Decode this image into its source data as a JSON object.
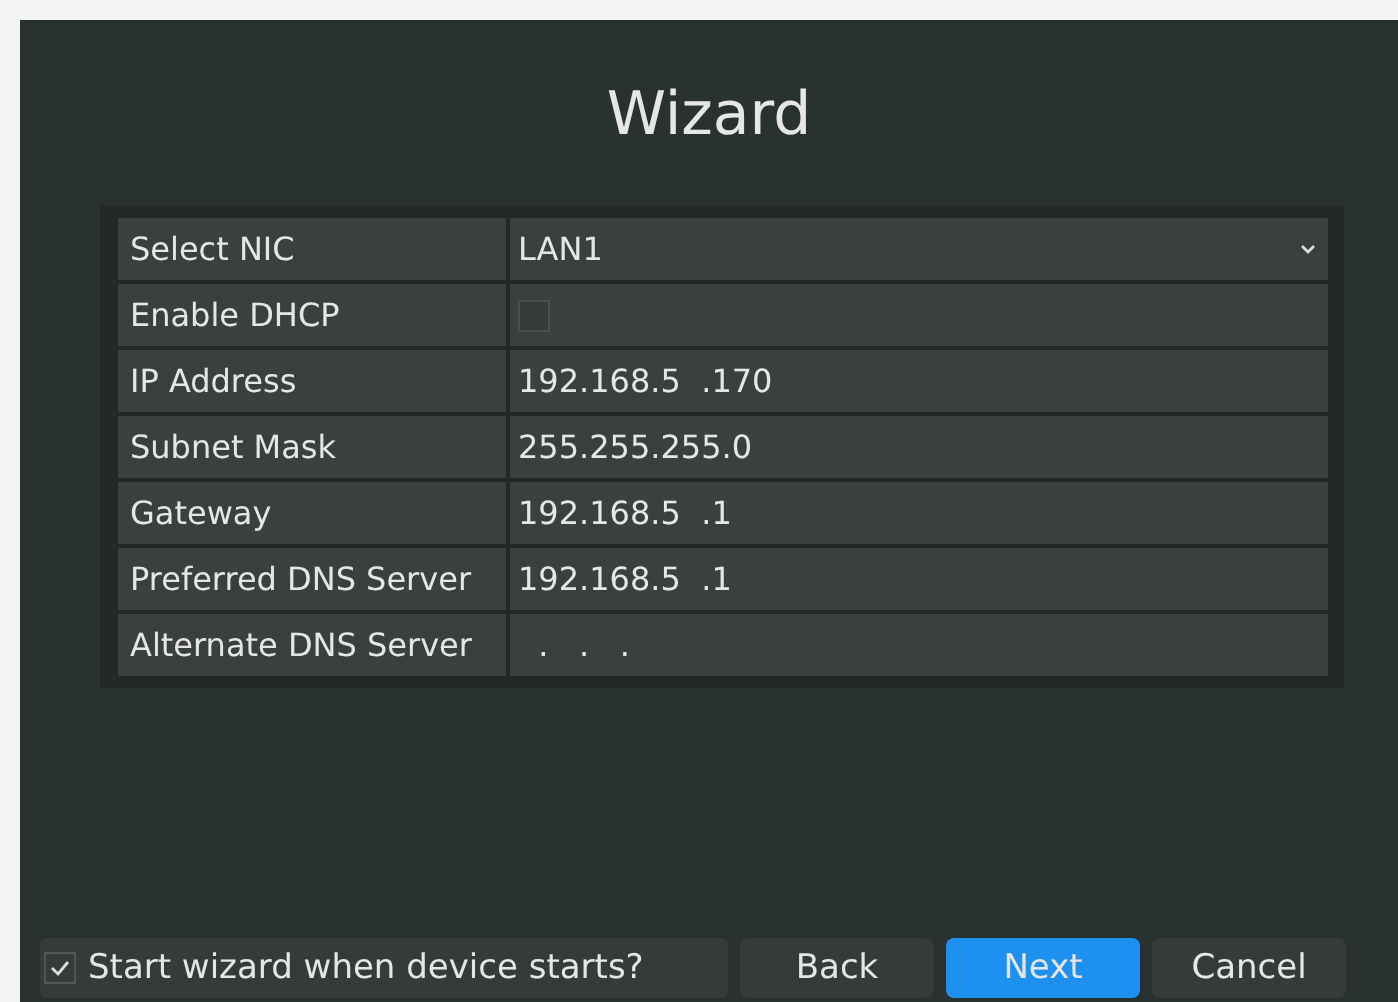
{
  "window": {
    "title": "Wizard"
  },
  "fields": [
    {
      "label": "Select NIC",
      "kind": "select",
      "value": "LAN1"
    },
    {
      "label": "Enable DHCP",
      "kind": "checkbox",
      "checked": false
    },
    {
      "label": "IP Address",
      "kind": "text",
      "value": "192.168.5  .170"
    },
    {
      "label": "Subnet Mask",
      "kind": "text",
      "value": "255.255.255.0"
    },
    {
      "label": "Gateway",
      "kind": "text",
      "value": "192.168.5  .1"
    },
    {
      "label": "Preferred DNS Server",
      "kind": "text",
      "value": "192.168.5  .1"
    },
    {
      "label": "Alternate DNS Server",
      "kind": "text",
      "value": "  .   .   ."
    }
  ],
  "startup_option": {
    "label": "Start wizard when device starts?",
    "checked": true
  },
  "buttons": [
    {
      "label": "Back",
      "selected": false
    },
    {
      "label": "Next",
      "selected": true
    },
    {
      "label": "Cancel",
      "selected": false
    }
  ]
}
